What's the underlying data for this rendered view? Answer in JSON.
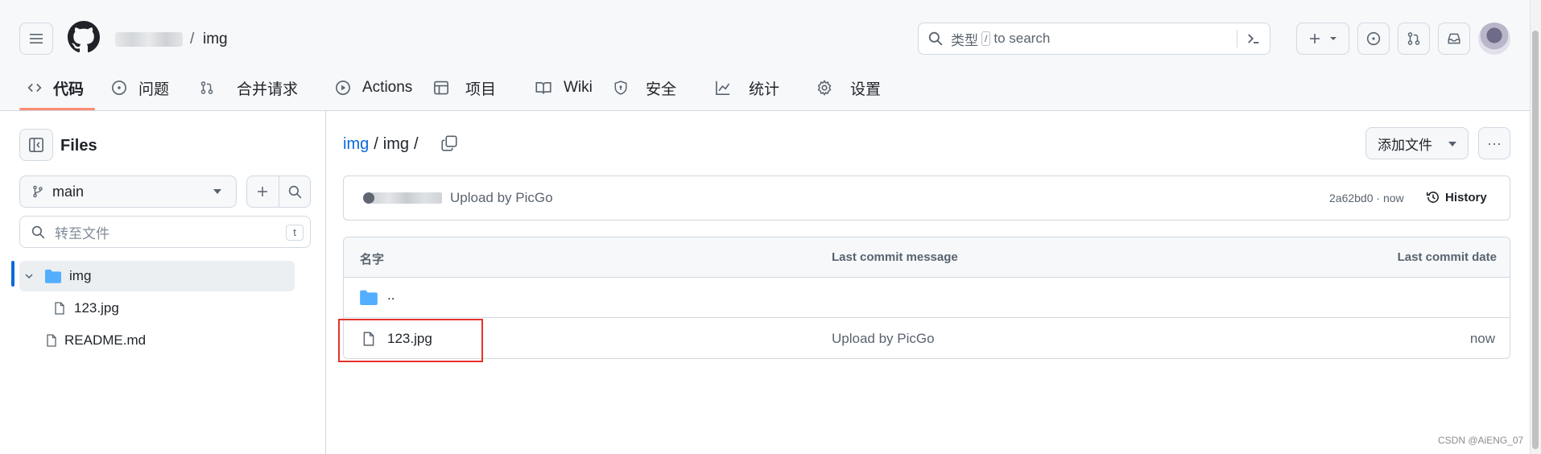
{
  "header": {
    "path_separator": "/",
    "repo_name": "img",
    "search": {
      "before": "类型",
      "key": "/",
      "after": "to search"
    }
  },
  "tabs": [
    {
      "label": "代码",
      "icon": "code-icon"
    },
    {
      "label": "问题",
      "icon": "issue-opened-icon"
    },
    {
      "label": "合并请求",
      "icon": "git-pull-request-icon"
    },
    {
      "label": "Actions",
      "icon": "play-icon"
    },
    {
      "label": "项目",
      "icon": "table-icon"
    },
    {
      "label": "Wiki",
      "icon": "book-icon"
    },
    {
      "label": "安全",
      "icon": "shield-icon"
    },
    {
      "label": "统计",
      "icon": "graph-icon"
    },
    {
      "label": "设置",
      "icon": "gear-icon"
    }
  ],
  "sidebar": {
    "title": "Files",
    "branch": "main",
    "goto_placeholder": "转至文件",
    "goto_shortcut": "t",
    "tree": [
      {
        "label": "img",
        "type": "folder",
        "expanded": true
      },
      {
        "label": "123.jpg",
        "type": "file"
      },
      {
        "label": "README.md",
        "type": "file"
      }
    ]
  },
  "main": {
    "breadcrumb": {
      "root": "img",
      "sep": "/",
      "current": "img"
    },
    "add_file_label": "添加文件",
    "more_label": "···",
    "commit": {
      "message": "Upload by PicGo",
      "sha": "2a62bd0 · now",
      "history_label": "History"
    },
    "table": {
      "headers": {
        "name": "名字",
        "message": "Last commit message",
        "date": "Last commit date"
      },
      "parent_label": "..",
      "rows": [
        {
          "name": "123.jpg",
          "message": "Upload by PicGo",
          "date": "now"
        }
      ]
    }
  },
  "watermark": "CSDN @AiENG_07",
  "colors": {
    "accent_link": "#0969da",
    "tab_underline": "#fd8c73",
    "folder": "#54aeff",
    "highlight": "#e5322d"
  }
}
